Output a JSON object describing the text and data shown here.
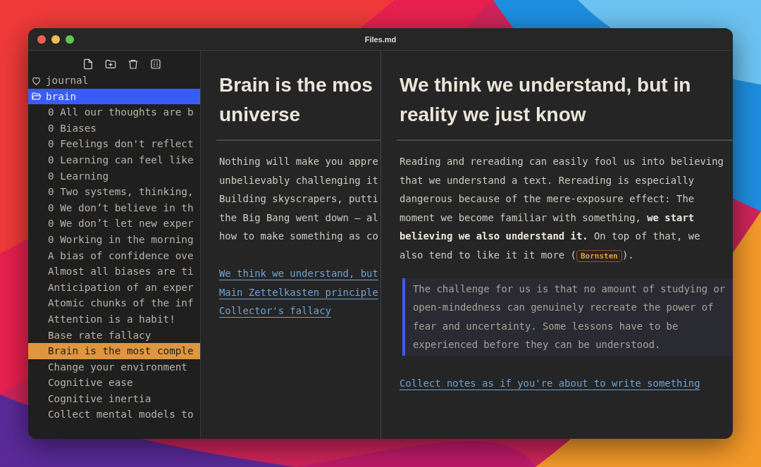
{
  "window": {
    "title": "Files.md"
  },
  "toolbar": [
    {
      "kind": "new-file"
    },
    {
      "kind": "new-folder"
    },
    {
      "kind": "delete"
    },
    {
      "kind": "columns"
    }
  ],
  "sidebar": {
    "items": [
      {
        "label": "journal",
        "kind": "favorite",
        "selected": false
      },
      {
        "label": "brain",
        "kind": "folder",
        "selected": true,
        "expanded": true,
        "children": [
          {
            "label": "0 All our thoughts are b",
            "selected": false
          },
          {
            "label": "0 Biases",
            "selected": false
          },
          {
            "label": "0 Feelings don't reflect",
            "selected": false
          },
          {
            "label": "0 Learning can feel like",
            "selected": false
          },
          {
            "label": "0 Learning",
            "selected": false
          },
          {
            "label": "0 Two systems, thinking,",
            "selected": false
          },
          {
            "label": "0 We don’t believe in th",
            "selected": false
          },
          {
            "label": "0 We don’t let new exper",
            "selected": false
          },
          {
            "label": "0 Working in the morning",
            "selected": false
          },
          {
            "label": "A bias of confidence ove",
            "selected": false
          },
          {
            "label": "Almost all biases are ti",
            "selected": false
          },
          {
            "label": "Anticipation of an exper",
            "selected": false
          },
          {
            "label": "Atomic chunks of the inf",
            "selected": false
          },
          {
            "label": "Attention is a habit!",
            "selected": false
          },
          {
            "label": "Base rate fallacy",
            "selected": false
          },
          {
            "label": "Brain is the most comple",
            "selected": true
          },
          {
            "label": "Change your environment",
            "selected": false
          },
          {
            "label": "Cognitive ease",
            "selected": false
          },
          {
            "label": "Cognitive inertia",
            "selected": false
          },
          {
            "label": "Collect mental models to",
            "selected": false
          }
        ]
      }
    ]
  },
  "left_note": {
    "heading_lines": [
      "Brain is the mos",
      "universe"
    ],
    "paragraph_lines": [
      "Nothing will make you appre",
      "unbelievably challenging it",
      "Building skyscrapers, putti",
      "the Big Bang went down – al",
      "how to make something as co"
    ],
    "links": [
      "We think we understand, but",
      "Main Zettelkasten principle",
      "Collector's fallacy"
    ]
  },
  "right_note": {
    "heading": "We think we understand, but in reality we just know",
    "paragraph": "Reading and rereading can easily fool us into believing that we understand a text. Rereading is especially dangerous because of the mere-exposure effect: The moment we become familiar with something, **we start believing we also understand it.** On top of that, we also tend to like it it more (",
    "citation": "Bornsten",
    "paragraph_end": ").",
    "quote": "The challenge for us is that no amount of studying or open-mindedness can genuinely recreate the power of fear and  uncertainty. Some lessons have to be experienced before they can be understood.",
    "link": "Collect notes as if you're about to write something"
  }
}
